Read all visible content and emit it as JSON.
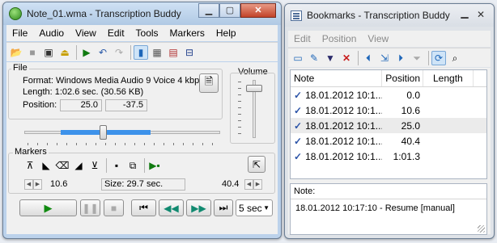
{
  "main_window": {
    "title": "Note_01.wma - Transcription Buddy",
    "menu": [
      "File",
      "Audio",
      "View",
      "Edit",
      "Tools",
      "Markers",
      "Help"
    ],
    "file_group": {
      "label": "File",
      "format": "Format: Windows Media Audio 9 Voice 4 kbp",
      "length": "Length: 1:02.6 sec. (30.56 KB)",
      "position_label": "Position:",
      "position_value_1": "25.0",
      "position_value_2": "-37.5"
    },
    "volume_label": "Volume",
    "playback_progress": 0.4,
    "volume_level": 0.9,
    "markers": {
      "label": "Markers",
      "start_value": "10.6",
      "size_text": "Size: 29.7 sec.",
      "end_value": "40.4"
    },
    "skip_interval": "5 sec"
  },
  "bookmarks_window": {
    "title": "Bookmarks - Transcription Buddy",
    "menu": [
      "Edit",
      "Position",
      "View"
    ],
    "columns": [
      "Note",
      "Position",
      "Length"
    ],
    "rows": [
      {
        "note": "18.01.2012 10:1...",
        "position": "0.0",
        "length": ""
      },
      {
        "note": "18.01.2012 10:1...",
        "position": "10.6",
        "length": ""
      },
      {
        "note": "18.01.2012 10:1...",
        "position": "25.0",
        "length": ""
      },
      {
        "note": "18.01.2012 10:1...",
        "position": "40.4",
        "length": ""
      },
      {
        "note": "18.01.2012 10:1...",
        "position": "1:01.3",
        "length": ""
      }
    ],
    "note_label": "Note:",
    "note_text": "18.01.2012 10:17:10 - Resume [manual]"
  }
}
